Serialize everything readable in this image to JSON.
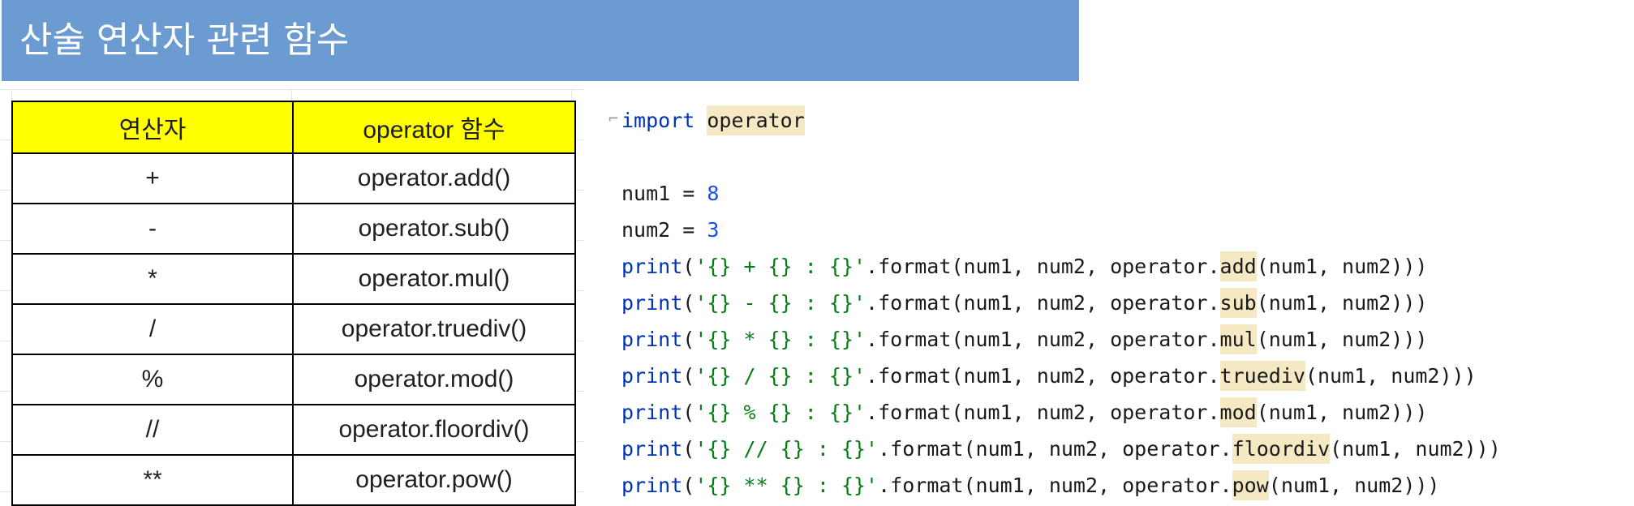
{
  "title": "산술 연산자 관련 함수",
  "table": {
    "headers": [
      "연산자",
      "operator 함수"
    ],
    "rows": [
      [
        "+",
        "operator.add()"
      ],
      [
        "-",
        "operator.sub()"
      ],
      [
        "*",
        "operator.mul()"
      ],
      [
        "/",
        "operator.truediv()"
      ],
      [
        "%",
        "operator.mod()"
      ],
      [
        "//",
        "operator.floordiv()"
      ],
      [
        "**",
        "operator.pow()"
      ]
    ]
  },
  "code": {
    "import_keyword": "import",
    "module": "operator",
    "assignments": [
      {
        "name": "num1",
        "op": " = ",
        "value": "8"
      },
      {
        "name": "num2",
        "op": " = ",
        "value": "3"
      }
    ],
    "print_keyword": "print",
    "prints": [
      {
        "fmt": "'{} + {} : {}'",
        "mid": ".format(num1, num2, operator.",
        "func": "add",
        "end": "(num1, num2)))"
      },
      {
        "fmt": "'{} - {} : {}'",
        "mid": ".format(num1, num2, operator.",
        "func": "sub",
        "end": "(num1, num2)))"
      },
      {
        "fmt": "'{} * {} : {}'",
        "mid": ".format(num1, num2, operator.",
        "func": "mul",
        "end": "(num1, num2)))"
      },
      {
        "fmt": "'{} / {} : {}'",
        "mid": ".format(num1, num2, operator.",
        "func": "truediv",
        "end": "(num1, num2)))"
      },
      {
        "fmt": "'{} % {} : {}'",
        "mid": ".format(num1, num2, operator.",
        "func": "mod",
        "end": "(num1, num2)))"
      },
      {
        "fmt": "'{} // {} : {}'",
        "mid": ".format(num1, num2, operator.",
        "func": "floordiv",
        "end": "(num1, num2)))"
      },
      {
        "fmt": "'{} ** {} : {}'",
        "mid": ".format(num1, num2, operator.",
        "func": "pow",
        "end": "(num1, num2)))"
      }
    ],
    "colors": {
      "keyword": "#0033b3",
      "number": "#1750eb",
      "string": "#067d17",
      "highlight": "#f5e9c4"
    }
  },
  "colors": {
    "title_bar": "#6b9bd1",
    "header_fill": "#ffff00"
  }
}
